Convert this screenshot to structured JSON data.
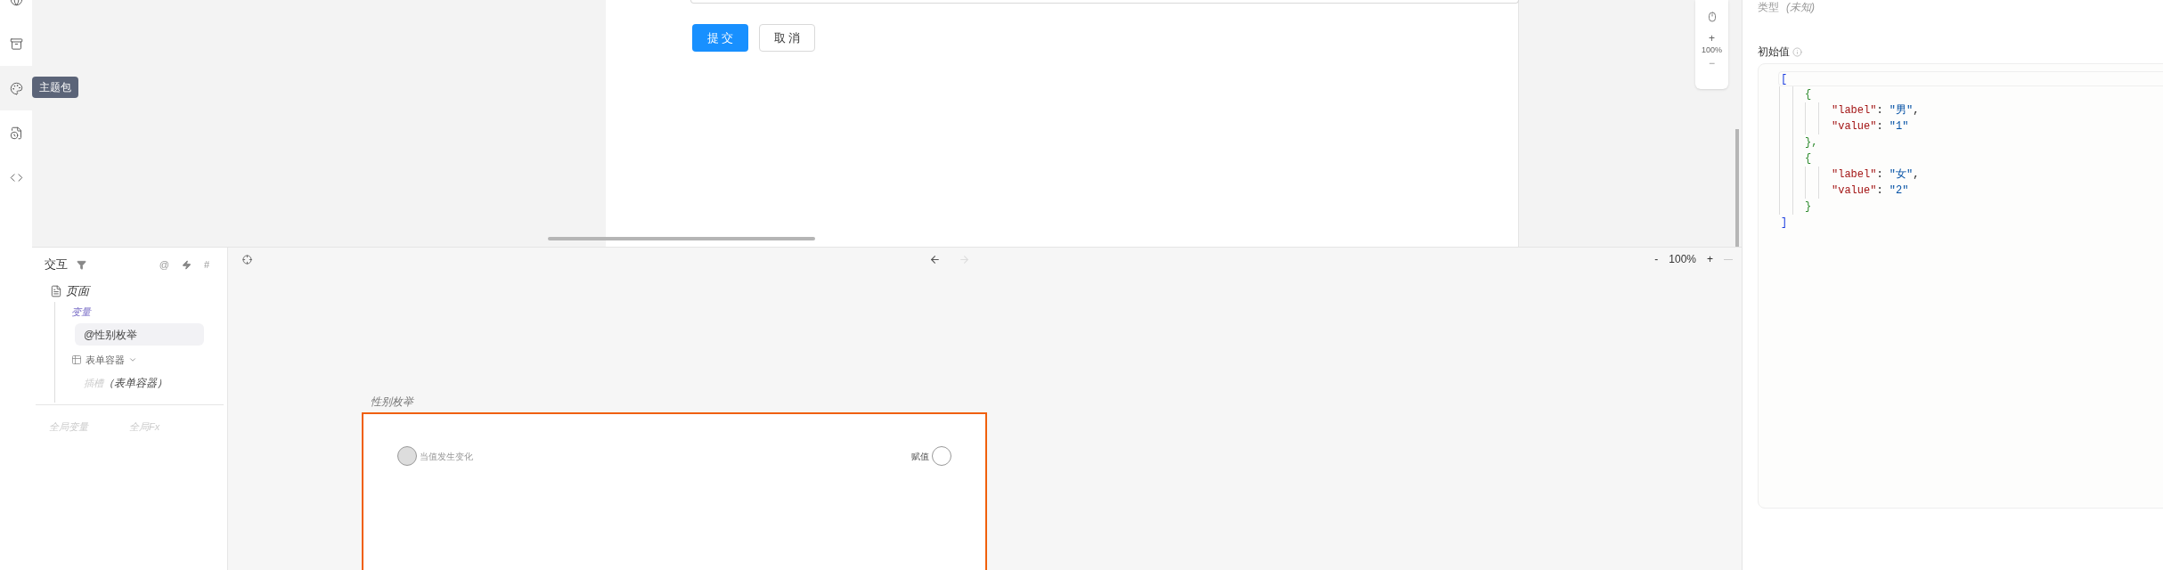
{
  "rail": {
    "items": [
      {
        "kind": "globe",
        "selected": false
      },
      {
        "kind": "archive",
        "selected": false
      },
      {
        "kind": "palette",
        "selected": true
      },
      {
        "kind": "document",
        "selected": false
      },
      {
        "kind": "code",
        "selected": false
      }
    ],
    "tooltip": "主题包"
  },
  "form": {
    "buttons": [
      {
        "label": "提 交",
        "kind": "primary"
      },
      {
        "label": "取 消",
        "kind": "default"
      }
    ]
  },
  "zoom_widget": {
    "plus": "+",
    "reading": "100%",
    "minus": "−"
  },
  "interaction_panel": {
    "title": "交互",
    "tools": [
      {
        "kind": "text",
        "text": "@"
      },
      {
        "kind": "bolt"
      },
      {
        "kind": "text",
        "text": "#"
      }
    ],
    "tree": [
      {
        "kind": "page",
        "label": "页面",
        "children": [
          {
            "kind": "group",
            "label": "变量",
            "children": [
              {
                "kind": "variable",
                "prefix": "@",
                "label": "性别枚举",
                "selected": true
              }
            ]
          },
          {
            "kind": "component",
            "label": "表单容器",
            "expanded": true,
            "children": [
              {
                "kind": "slot",
                "label": "插槽",
                "detail": "（表单容器）"
              }
            ]
          }
        ]
      }
    ],
    "bottom_tabs": [
      {
        "label": "全局变量",
        "selected": false
      },
      {
        "label": "全局Fx",
        "selected": false
      }
    ]
  },
  "canvas": {
    "back_disabled": false,
    "forward_disabled": true,
    "zoom": {
      "minus": "-",
      "reading": "100%",
      "plus": "+"
    },
    "card": {
      "title": "性别枚举",
      "ports": [
        {
          "kind": "event",
          "label": "当值发生变化"
        },
        {
          "kind": "action",
          "label": "赋值"
        }
      ]
    }
  },
  "properties": {
    "type_label": "类型",
    "type_value": "(未知)",
    "initial_value_label": "初始值",
    "code": {
      "open": "[",
      "close": "]",
      "children": [
        {
          "open": "{",
          "close": "},",
          "lines": [
            [
              {
                "kind": "key",
                "text": "\"label\""
              },
              {
                "kind": "punct",
                "text": ": "
              },
              {
                "kind": "string",
                "text": "\"男\""
              },
              {
                "kind": "punct",
                "text": ","
              }
            ],
            [
              {
                "kind": "key",
                "text": "\"value\""
              },
              {
                "kind": "punct",
                "text": ": "
              },
              {
                "kind": "string",
                "text": "\"1\""
              }
            ]
          ]
        },
        {
          "open": "{",
          "close": "}",
          "lines": [
            [
              {
                "kind": "key",
                "text": "\"label\""
              },
              {
                "kind": "punct",
                "text": ": "
              },
              {
                "kind": "string",
                "text": "\"女\""
              },
              {
                "kind": "punct",
                "text": ","
              }
            ],
            [
              {
                "kind": "key",
                "text": "\"value\""
              },
              {
                "kind": "punct",
                "text": ": "
              },
              {
                "kind": "string",
                "text": "\"2\""
              }
            ]
          ]
        }
      ]
    }
  }
}
